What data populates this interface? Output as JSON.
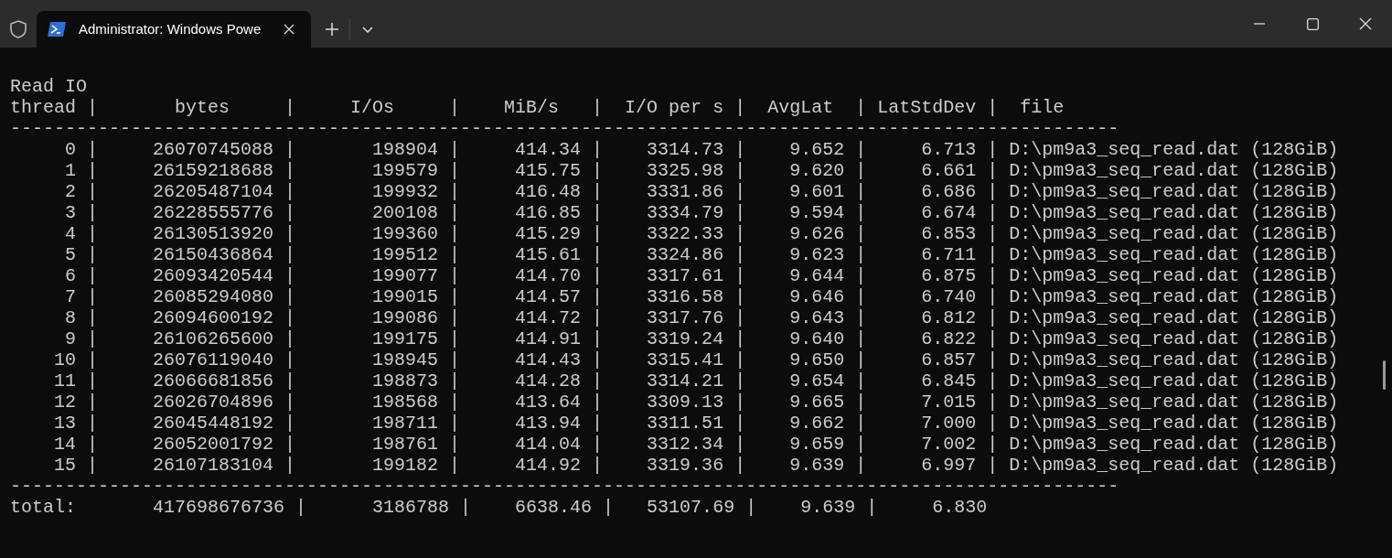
{
  "tabs": [
    {
      "title": "Administrator: Windows Powe",
      "selected": true
    }
  ],
  "terminal": {
    "lines": [
      "Read IO",
      "thread |       bytes     |     I/Os     |    MiB/s   |  I/O per s |  AvgLat  | LatStdDev |  file",
      "-----------------------------------------------------------------------------------------------------",
      "     0 |     26070745088 |       198904 |     414.34 |    3314.73 |    9.652 |     6.713 | D:\\pm9a3_seq_read.dat (128GiB)",
      "     1 |     26159218688 |       199579 |     415.75 |    3325.98 |    9.620 |     6.661 | D:\\pm9a3_seq_read.dat (128GiB)",
      "     2 |     26205487104 |       199932 |     416.48 |    3331.86 |    9.601 |     6.686 | D:\\pm9a3_seq_read.dat (128GiB)",
      "     3 |     26228555776 |       200108 |     416.85 |    3334.79 |    9.594 |     6.674 | D:\\pm9a3_seq_read.dat (128GiB)",
      "     4 |     26130513920 |       199360 |     415.29 |    3322.33 |    9.626 |     6.853 | D:\\pm9a3_seq_read.dat (128GiB)",
      "     5 |     26150436864 |       199512 |     415.61 |    3324.86 |    9.623 |     6.711 | D:\\pm9a3_seq_read.dat (128GiB)",
      "     6 |     26093420544 |       199077 |     414.70 |    3317.61 |    9.644 |     6.875 | D:\\pm9a3_seq_read.dat (128GiB)",
      "     7 |     26085294080 |       199015 |     414.57 |    3316.58 |    9.646 |     6.740 | D:\\pm9a3_seq_read.dat (128GiB)",
      "     8 |     26094600192 |       199086 |     414.72 |    3317.76 |    9.643 |     6.812 | D:\\pm9a3_seq_read.dat (128GiB)",
      "     9 |     26106265600 |       199175 |     414.91 |    3319.24 |    9.640 |     6.822 | D:\\pm9a3_seq_read.dat (128GiB)",
      "    10 |     26076119040 |       198945 |     414.43 |    3315.41 |    9.650 |     6.857 | D:\\pm9a3_seq_read.dat (128GiB)",
      "    11 |     26066681856 |       198873 |     414.28 |    3314.21 |    9.654 |     6.845 | D:\\pm9a3_seq_read.dat (128GiB)",
      "    12 |     26026704896 |       198568 |     413.64 |    3309.13 |    9.665 |     7.015 | D:\\pm9a3_seq_read.dat (128GiB)",
      "    13 |     26045448192 |       198711 |     413.94 |    3311.51 |    9.662 |     7.000 | D:\\pm9a3_seq_read.dat (128GiB)",
      "    14 |     26052001792 |       198761 |     414.04 |    3312.34 |    9.659 |     7.002 | D:\\pm9a3_seq_read.dat (128GiB)",
      "    15 |     26107183104 |       199182 |     414.92 |    3319.36 |    9.639 |     6.997 | D:\\pm9a3_seq_read.dat (128GiB)",
      "-----------------------------------------------------------------------------------------------------",
      "total:       417698676736 |      3186788 |    6638.46 |   53107.69 |    9.639 |     6.830"
    ]
  }
}
